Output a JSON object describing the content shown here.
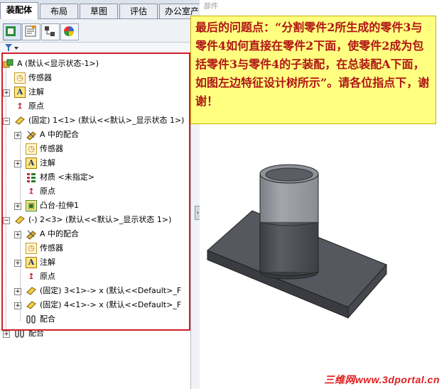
{
  "tabs": [
    {
      "label": "装配体",
      "active": true
    },
    {
      "label": "布局",
      "active": false
    },
    {
      "label": "草图",
      "active": false
    },
    {
      "label": "评估",
      "active": false
    },
    {
      "label": "办公室产品",
      "active": false
    }
  ],
  "toolbar": {
    "icons": [
      "featuremanager-icon",
      "propertymanager-icon",
      "configurationmanager-icon",
      "appearance-icon"
    ]
  },
  "filter": {
    "icon": "filter-icon"
  },
  "tree": {
    "root": "A  (默认<显示状态-1>)",
    "sensors": "传感器",
    "annotations": "注解",
    "origin": "原点",
    "comp1": "(固定) 1<1> (默认<<默认>_显示状态 1>)",
    "comp1_mates": "A 中的配合",
    "comp1_sensors": "传感器",
    "comp1_annotations": "注解",
    "comp1_material": "材质 <未指定>",
    "comp1_origin": "原点",
    "comp1_boss": "凸台-拉伸1",
    "comp2": "(-) 2<3> (默认<<默认>_显示状态 1>)",
    "comp2_mates": "A 中的配合",
    "comp2_sensors": "传感器",
    "comp2_annotations": "注解",
    "comp2_origin": "原点",
    "comp3": "(固定) 3<1>-> x (默认<<Default>_F",
    "comp4": "(固定) 4<1>-> x (默认<<Default>_F",
    "comp2_matesgroup": "配合",
    "mates": "配合"
  },
  "callout": {
    "text": "最后的问题点：“分割零件2所生成的零件3与零件4如何直接在零件2下面，使零件2成为包括零件3与零件4的子装配，在总装配A下面，如图左边特征设计树所示”。请各位指点下，谢谢！"
  },
  "viewport": {
    "top_label": "部件"
  },
  "watermark": "三维网www.3dportal.cn",
  "colors": {
    "highlight_frame": "#d21f2a",
    "callout_bg": "#ffff80",
    "callout_text": "#b01515"
  }
}
